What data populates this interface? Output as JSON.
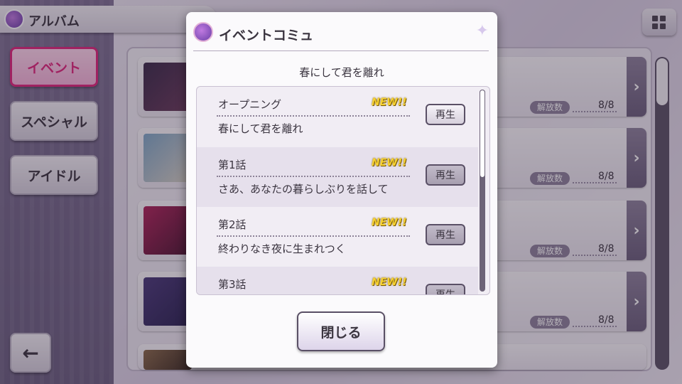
{
  "header": {
    "title": "アルバム",
    "icon": "album-icon"
  },
  "sidebar": {
    "tabs": [
      {
        "label": "イベント",
        "active": true
      },
      {
        "label": "スペシャル",
        "active": false
      },
      {
        "label": "アイドル",
        "active": false
      }
    ],
    "back_icon": "←"
  },
  "list": {
    "cards": [
      {
        "unlock_label": "解放数",
        "count": "8/8"
      },
      {
        "unlock_label": "解放数",
        "count": "8/8"
      },
      {
        "unlock_label": "解放数",
        "count": "8/8"
      },
      {
        "unlock_label": "解放数",
        "count": "8/8"
      }
    ]
  },
  "modal": {
    "title": "イベントコミュ",
    "subtitle": "春にして君を離れ",
    "episodes": [
      {
        "name": "オープニング",
        "title": "春にして君を離れ",
        "badge": "NEW!!",
        "play_label": "再生"
      },
      {
        "name": "第1話",
        "title": "さあ、あなたの暮らしぶりを話して",
        "badge": "NEW!!",
        "play_label": "再生"
      },
      {
        "name": "第2話",
        "title": "終わりなき夜に生まれつく",
        "badge": "NEW!!",
        "play_label": "再生"
      },
      {
        "name": "第3話",
        "title": "",
        "badge": "NEW!!",
        "play_label": "再生"
      }
    ],
    "close_label": "閉じる"
  },
  "colors": {
    "accent": "#e0267c",
    "badge": "#f5d032",
    "panel": "#fbfafc"
  }
}
